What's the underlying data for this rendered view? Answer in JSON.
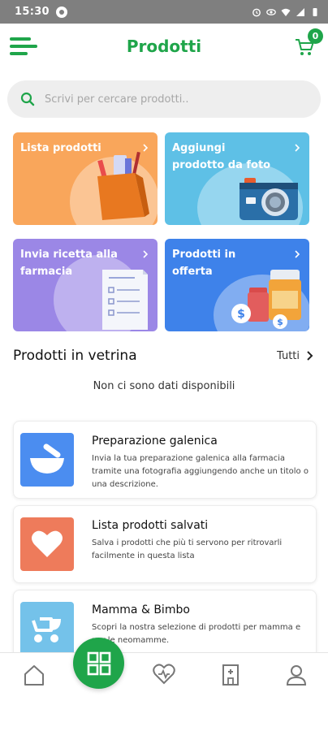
{
  "status_bar": {
    "time": "15:30"
  },
  "header": {
    "title": "Prodotti",
    "cart_count": "0"
  },
  "search": {
    "placeholder": "Scrivi per cercare prodotti.."
  },
  "tiles": [
    {
      "label": "Lista prodotti",
      "color": "#f9a65b"
    },
    {
      "label": "Aggiungi prodotto da foto",
      "color": "#5ec0e6"
    },
    {
      "label": "Invia ricetta alla farmacia",
      "color": "#9b87e6"
    },
    {
      "label": "Prodotti in offerta",
      "color": "#3e82ea"
    }
  ],
  "showcase": {
    "title": "Prodotti in vetrina",
    "see_all": "Tutti",
    "empty_message": "Non ci sono dati disponibili"
  },
  "cards": [
    {
      "title": "Preparazione galenica",
      "description": "Invia la tua preparazione galenica alla farmacia tramite una fotografia aggiungendo anche un titolo o una descrizione.",
      "icon": "mortar-pestle-icon",
      "color": "#4b8df0"
    },
    {
      "title": "Lista prodotti salvati",
      "description": "Salva i prodotti che più ti servono per ritrovarli facilmente in questa lista",
      "icon": "heart-icon",
      "color": "#ee7b5b"
    },
    {
      "title": "Mamma & Bimbo",
      "description": "Scopri la nostra selezione di prodotti per mamma e per le neomamme.",
      "icon": "stroller-icon",
      "color": "#74c2ea"
    }
  ],
  "bottom_nav": {
    "items": [
      "home-icon",
      "products-grid-icon",
      "heart-hand-icon",
      "pharmacy-building-icon",
      "user-icon"
    ],
    "active": "products-grid-icon"
  },
  "colors": {
    "brand_green": "#1fa54a"
  }
}
